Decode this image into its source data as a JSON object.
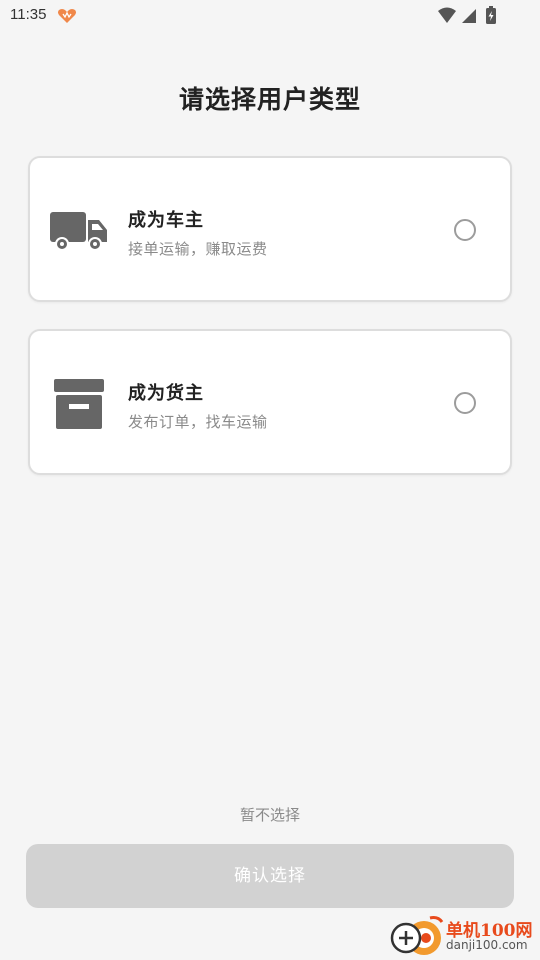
{
  "status_bar": {
    "time": "11:35",
    "app_icon": "heart-app-icon",
    "icons": [
      "wifi-icon",
      "cellular-signal-icon",
      "battery-charging-icon"
    ]
  },
  "page": {
    "title": "请选择用户类型"
  },
  "options": [
    {
      "title": "成为车主",
      "description": "接单运输，赚取运费",
      "icon": "truck-icon",
      "selected": false
    },
    {
      "title": "成为货主",
      "description": "发布订单，找车运输",
      "icon": "archive-box-icon",
      "selected": false
    }
  ],
  "actions": {
    "skip_label": "暂不选择",
    "confirm_label": "确认选择",
    "confirm_enabled": false
  },
  "watermark": {
    "name": "单机100网",
    "url": "danji100.com"
  },
  "colors": {
    "background": "#f5f5f5",
    "card_border": "#dddddd",
    "icon_gray": "#666666",
    "disabled_button": "#d2d2d2",
    "watermark_accent": "#e84a1c"
  }
}
